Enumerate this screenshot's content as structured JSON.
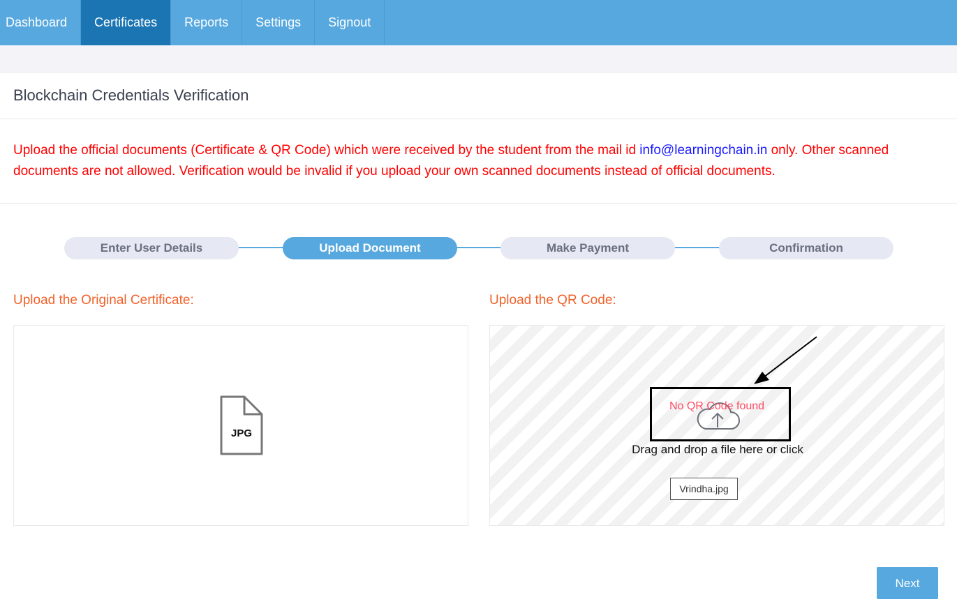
{
  "nav": {
    "items": [
      {
        "label": "Dashboard",
        "active": false
      },
      {
        "label": "Certificates",
        "active": true
      },
      {
        "label": "Reports",
        "active": false
      },
      {
        "label": "Settings",
        "active": false
      },
      {
        "label": "Signout",
        "active": false
      }
    ]
  },
  "page": {
    "title": "Blockchain Credentials Verification"
  },
  "notice": {
    "text_before": "Upload the official documents (Certificate & QR Code) which were received by the student from the mail id ",
    "email": "info@learningchain.in",
    "text_after": " only. Other scanned documents are not allowed. Verification would be invalid if you upload your own scanned documents instead of official documents."
  },
  "stepper": {
    "steps": [
      {
        "label": "Enter User Details",
        "active": false
      },
      {
        "label": "Upload Document",
        "active": true
      },
      {
        "label": "Make Payment",
        "active": false
      },
      {
        "label": "Confirmation",
        "active": false
      }
    ]
  },
  "certificate_upload": {
    "label": "Upload the Original Certificate:",
    "file_type": "JPG"
  },
  "qr_upload": {
    "label": "Upload the QR Code:",
    "error": "No QR Code found",
    "drop_text": "Drag and drop a file here or click",
    "file_name": "Vrindha.jpg"
  },
  "actions": {
    "next_label": "Next"
  },
  "colors": {
    "nav_bg": "#56a8df",
    "nav_active": "#1b75b3",
    "notice": "#ff0000",
    "section_label": "#f0622a",
    "error": "#ff4b63"
  }
}
